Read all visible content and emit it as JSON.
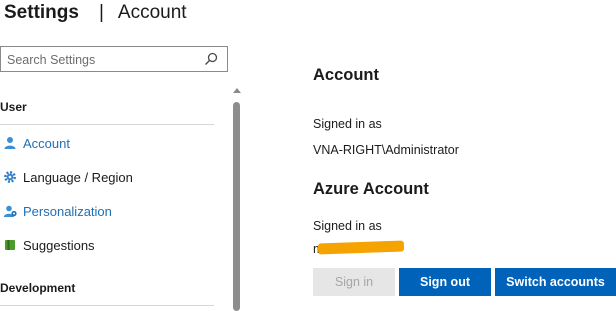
{
  "header": {
    "title": "Settings",
    "separator": "|",
    "subtitle": "Account"
  },
  "search": {
    "placeholder": "Search Settings",
    "icon": "search-icon"
  },
  "sidebar": {
    "sections": [
      {
        "label": "User",
        "items": [
          {
            "label": "Account",
            "icon": "person-icon",
            "selected": true
          },
          {
            "label": "Language / Region",
            "icon": "gear-icon"
          },
          {
            "label": "Personalization",
            "icon": "personalization-icon"
          },
          {
            "label": "Suggestions",
            "icon": "book-icon"
          }
        ]
      },
      {
        "label": "Development",
        "items": []
      }
    ]
  },
  "main": {
    "account_heading": "Account",
    "signed_in_label": "Signed in as",
    "account_user": "VNA-RIGHT\\Administrator",
    "azure_heading": "Azure Account",
    "azure_signed_in_label": "Signed in as",
    "azure_user_visible": "m          t",
    "buttons": {
      "sign_in": "Sign in",
      "sign_out": "Sign out",
      "switch_accounts": "Switch accounts"
    }
  },
  "colors": {
    "accent": "#0062b8",
    "link": "#1f6fb5",
    "redaction": "#f5a300"
  }
}
